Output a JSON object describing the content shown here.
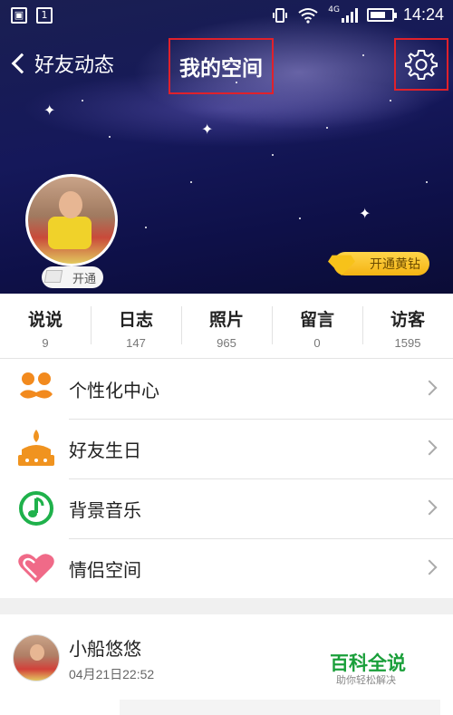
{
  "status_bar": {
    "time": "14:24",
    "network": "4G"
  },
  "nav": {
    "back_label": "好友动态",
    "title": "我的空间"
  },
  "profile": {
    "vip_badge": "开通",
    "gold_button": "开通黄钻"
  },
  "stats": [
    {
      "label": "说说",
      "count": "9"
    },
    {
      "label": "日志",
      "count": "147"
    },
    {
      "label": "照片",
      "count": "965"
    },
    {
      "label": "留言",
      "count": "0"
    },
    {
      "label": "访客",
      "count": "1595"
    }
  ],
  "menu": [
    {
      "label": "个性化中心",
      "icon": "mustache-icon"
    },
    {
      "label": "好友生日",
      "icon": "birthday-cake-icon"
    },
    {
      "label": "背景音乐",
      "icon": "music-note-icon"
    },
    {
      "label": "情侣空间",
      "icon": "heart-icon"
    }
  ],
  "feed": {
    "name": "小船悠悠",
    "time": "04月21日22:52"
  },
  "watermark": {
    "title": "百科全说",
    "subtitle": "助你轻松解决"
  },
  "colors": {
    "highlight": "#e0212b",
    "gold": "#f4b312",
    "brand_green": "#1a9f3a"
  }
}
